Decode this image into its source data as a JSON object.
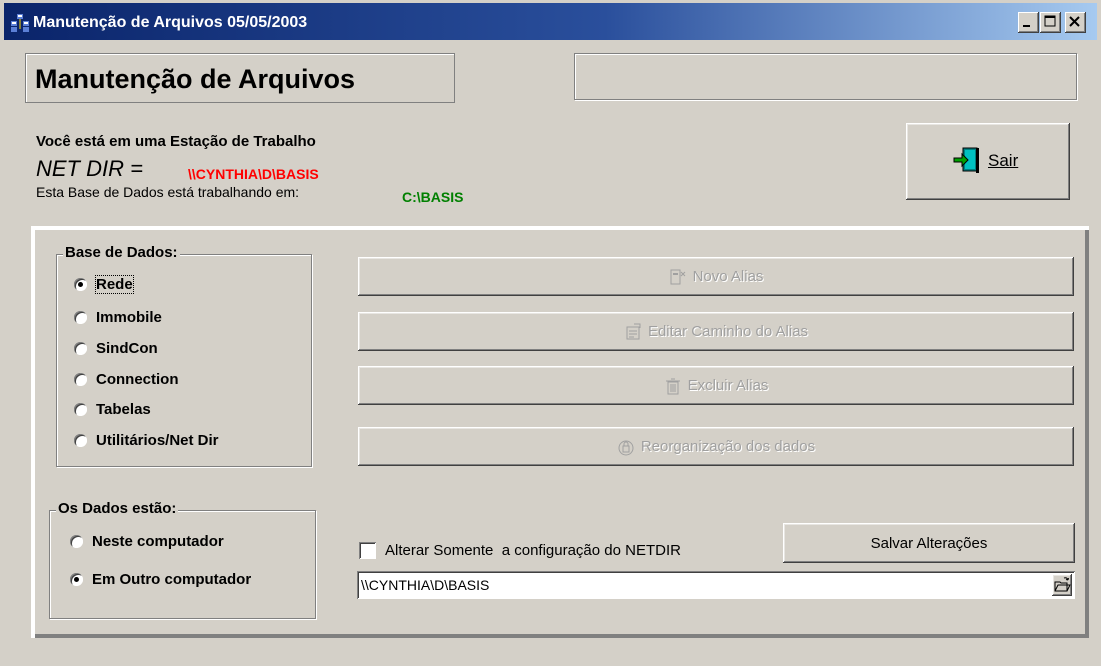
{
  "window": {
    "title": "Manutenção de Arquivos 05/05/2003"
  },
  "header": {
    "title": "Manutenção de Arquivos"
  },
  "info": {
    "station": "Você está em uma Estação de Trabalho",
    "netdir_label": "NET DIR =",
    "netdir_value": "\\\\CYNTHIA\\D\\BASIS",
    "database_label": "Esta Base de Dados está trabalhando em:",
    "database_path": "C:\\BASIS"
  },
  "sair": {
    "label": "Sair"
  },
  "base_dados": {
    "title": "Base de Dados:",
    "options": [
      "Rede",
      "Immobile",
      "SindCon",
      "Connection",
      "Tabelas",
      "Utilitários/Net Dir"
    ],
    "selected": "Rede"
  },
  "os_dados": {
    "title": "Os Dados estão:",
    "options": [
      "Neste computador",
      "Em Outro computador"
    ],
    "selected": "Em Outro computador"
  },
  "actions": {
    "novo_alias": "Novo Alias",
    "editar_caminho": "Editar Caminho do Alias",
    "excluir_alias": "Excluir Alias",
    "reorganizacao": "Reorganização dos dados"
  },
  "netdir_config": {
    "checkbox_label": "Alterar Somente  a configuração do NETDIR",
    "checked": false,
    "save_label": "Salvar Alterações",
    "path_value": "\\\\CYNTHIA\\D\\BASIS"
  }
}
